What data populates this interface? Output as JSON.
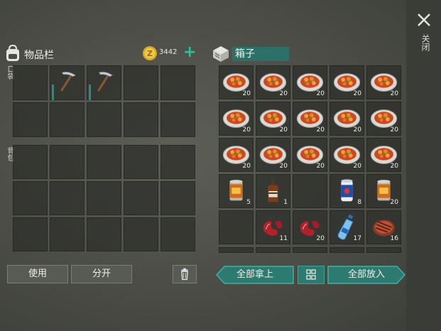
{
  "close": {
    "label": "关闭"
  },
  "inventory": {
    "title": "物品栏",
    "coins": "3442",
    "pocket_label": "口袋",
    "backpack_label": "背包",
    "pocket_slots": [
      {
        "item": null
      },
      {
        "item": "pickaxe"
      },
      {
        "item": "pickaxe"
      },
      {
        "item": null
      },
      {
        "item": null
      },
      {
        "item": null
      },
      {
        "item": null
      },
      {
        "item": null
      },
      {
        "item": null
      },
      {
        "item": null
      }
    ],
    "backpack_slots": 15
  },
  "buttons": {
    "use": "使用",
    "split": "分开",
    "take_all": "全部拿上",
    "put_all": "全部放入"
  },
  "box": {
    "title": "箱子",
    "slots": [
      {
        "item": "stew-plate",
        "qty": "20"
      },
      {
        "item": "stew-plate",
        "qty": "20"
      },
      {
        "item": "stew-plate",
        "qty": "20"
      },
      {
        "item": "stew-plate",
        "qty": "20"
      },
      {
        "item": "stew-plate",
        "qty": "20"
      },
      {
        "item": "stew-plate",
        "qty": "20"
      },
      {
        "item": "stew-plate",
        "qty": "20"
      },
      {
        "item": "stew-plate",
        "qty": "20"
      },
      {
        "item": "stew-plate",
        "qty": "20"
      },
      {
        "item": "stew-plate",
        "qty": "20"
      },
      {
        "item": "stew-plate",
        "qty": "20"
      },
      {
        "item": "stew-plate",
        "qty": "20"
      },
      {
        "item": "stew-plate",
        "qty": "20"
      },
      {
        "item": "stew-plate",
        "qty": "20"
      },
      {
        "item": "stew-plate",
        "qty": "20"
      },
      {
        "item": "canned-food",
        "qty": "5"
      },
      {
        "item": "whiskey-bottle",
        "qty": "1"
      },
      {
        "item": null,
        "qty": ""
      },
      {
        "item": "soda-can",
        "qty": "8"
      },
      {
        "item": "canned-food",
        "qty": "20"
      },
      {
        "item": null,
        "qty": ""
      },
      {
        "item": "raw-meat",
        "qty": "11"
      },
      {
        "item": "raw-meat",
        "qty": "20"
      },
      {
        "item": "water-bottle",
        "qty": "17"
      },
      {
        "item": "steak",
        "qty": "16"
      }
    ]
  },
  "colors": {
    "accent": "#2fc09e",
    "teal_button": "#2d7a70",
    "slot_bg": "#2e302c"
  }
}
